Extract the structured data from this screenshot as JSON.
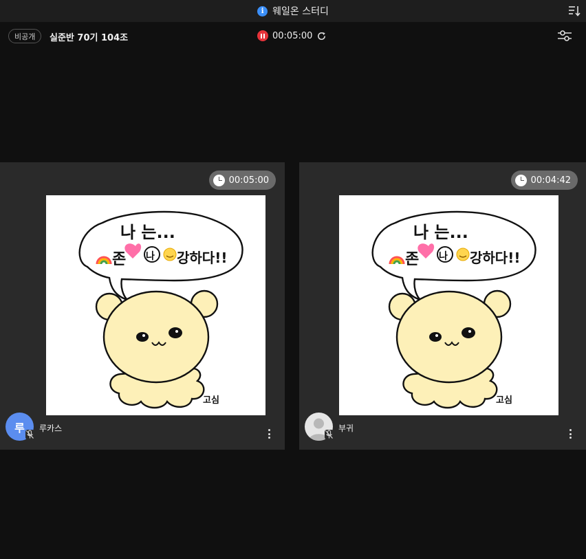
{
  "titlebar": {
    "title": "웨일온 스터디",
    "info_icon": "info-icon",
    "sort_icon": "sort-icon"
  },
  "room": {
    "visibility_badge": "비공개",
    "name": "실준반 70기 104조",
    "timer": "00:05:00",
    "pause_icon": "pause-icon",
    "refresh_icon": "refresh-icon",
    "settings_icon": "settings-icon"
  },
  "participants": [
    {
      "name": "루카스",
      "avatar_initial": "루",
      "avatar_color": "#5b8def",
      "timer": "00:05:00",
      "mic": "muted",
      "drawing": {
        "line1": "나 는...",
        "line2": "존",
        "circled": "나",
        "line2_end": "강하다!!",
        "signature": "고심"
      }
    },
    {
      "name": "부귀",
      "avatar_initial": "",
      "avatar_color": "#e6e6e6",
      "timer": "00:04:42",
      "mic": "muted",
      "drawing": {
        "line1": "나 는...",
        "line2": "존",
        "circled": "나",
        "line2_end": "강하다!!",
        "signature": "고심"
      }
    }
  ],
  "colors": {
    "background": "#101010",
    "tile": "#2a2a2a",
    "accent_red": "#e5333a",
    "accent_blue": "#3a8ef7",
    "bear": "#fdf0b8"
  }
}
